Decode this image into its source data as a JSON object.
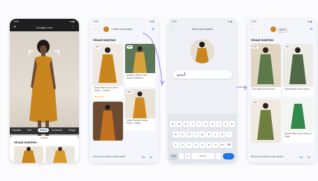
{
  "phone1": {
    "status_time": "8:00",
    "status_icons": "▾▴▮",
    "app_title": "Google Lens",
    "chips": [
      "Translate",
      "Text",
      "Search",
      "Homework",
      "Shoppi"
    ],
    "section_title": "Visual matches"
  },
  "phone2": {
    "status_time": "8:00",
    "status_icons": "▾▴▮",
    "add_to_search": "Add to your search",
    "section_title": "Visual matches",
    "results": [
      {
        "price": "$44",
        "title": "Rose Mini French Linen Dress - V-Neck...",
        "stars": "★★★★★"
      },
      {
        "price": "$89",
        "title": "Amazon Ochre Linen Dress | MIAmeru"
      },
      {
        "price": "$96",
        "title": "Jubila Ruched Yellow Dress - Yellow..."
      },
      {
        "price": "",
        "title": ""
      }
    ],
    "feedback": "Did you find these results useful?",
    "yes": "Yes",
    "no": "No"
  },
  "phone3": {
    "status_time": "8:00",
    "status_icons": "▾▴▮",
    "title": "Add to your search",
    "query": "green",
    "keyboard_rows": [
      [
        "q",
        "w",
        "e",
        "r",
        "t",
        "y",
        "u",
        "i",
        "o",
        "p"
      ],
      [
        "a",
        "s",
        "d",
        "f",
        "g",
        "h",
        "j",
        "k",
        "l"
      ],
      [
        "⇧",
        "z",
        "x",
        "c",
        "v",
        "b",
        "n",
        "m",
        "⌫"
      ]
    ],
    "key_symbols": "?123",
    "key_comma": ",",
    "key_space": "English",
    "key_period": "."
  },
  "phone4": {
    "status_time": "8:00",
    "status_icons": "▾▴▮",
    "query_chip": "green",
    "section_title": "Visual matches",
    "results": [
      {
        "price": "$47",
        "title": "Esk Moss Linen Dress..."
      },
      {
        "price": "$69",
        "title": "Shimmering Linen Dress..."
      },
      {
        "price": "$84",
        "title": ""
      },
      {
        "price": "",
        "title": "Antonia Mini Linen Dress in Sage..."
      }
    ],
    "feedback": "Did you find these results useful?",
    "yes": "Yes",
    "no": "No"
  },
  "colors": {
    "mustard": "#c9861f",
    "green": "#5b7a4a",
    "accent": "#1a73e8",
    "arrow": "#9b7be8"
  }
}
